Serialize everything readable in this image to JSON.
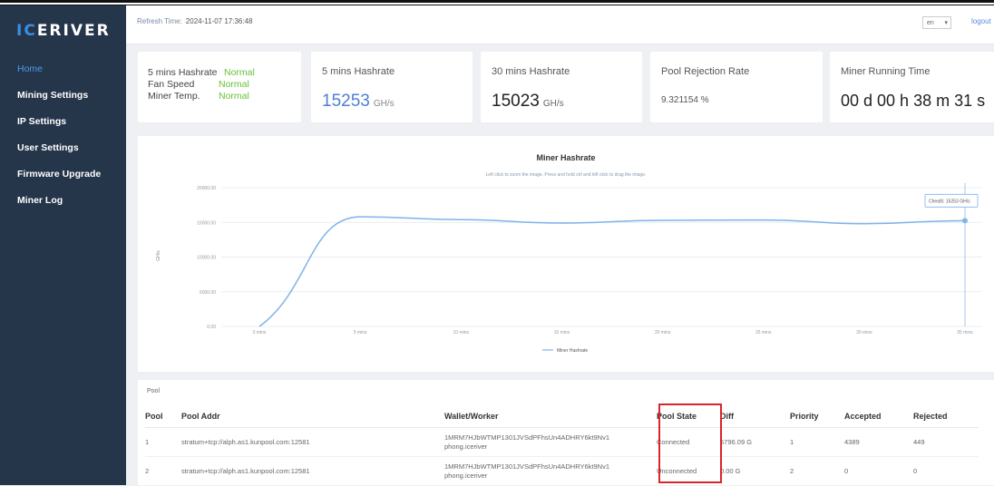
{
  "app": {
    "logo_prefix": "IC",
    "logo_suffix": "ERIVER"
  },
  "sidebar": {
    "items": [
      {
        "label": "Home"
      },
      {
        "label": "Mining Settings"
      },
      {
        "label": "IP Settings"
      },
      {
        "label": "User Settings"
      },
      {
        "label": "Firmware Upgrade"
      },
      {
        "label": "Miner Log"
      }
    ]
  },
  "topbar": {
    "refresh_label": "Refresh Time:",
    "refresh_value": "2024-11-07 17:36:48",
    "language": "en",
    "logout": "logout"
  },
  "status_card": {
    "rows": [
      {
        "label": "5 mins Hashrate",
        "status": "Normal"
      },
      {
        "label": "Fan Speed",
        "status": "Normal"
      },
      {
        "label": "Miner Temp.",
        "status": "Normal"
      }
    ]
  },
  "cards": {
    "hash5": {
      "title": "5 mins Hashrate",
      "value": "15253",
      "unit": "GH/s"
    },
    "hash30": {
      "title": "30 mins Hashrate",
      "value": "15023",
      "unit": "GH/s"
    },
    "rejection": {
      "title": "Pool Rejection Rate",
      "value": "9.321154 %"
    },
    "runtime": {
      "title": "Miner Running Time",
      "value": "00 d 00 h 38 m 31 s"
    }
  },
  "chart": {
    "title": "Miner Hashrate",
    "subtitle": "Left click to zoom the image. Press and hold ctrl and left click to drag the image.",
    "y_axis_label": "GH/s",
    "legend": "Miner Hashrate",
    "tooltip": "Cheat5: 15253 GH/s",
    "accent": "#7fb3ea"
  },
  "chart_data": {
    "type": "line",
    "title": "Miner Hashrate",
    "ylabel": "GH/s",
    "x": [
      "0 mins",
      "5 mins",
      "10 mins",
      "15 mins",
      "20 mins",
      "25 mins",
      "30 mins",
      "35 mins"
    ],
    "series": [
      {
        "name": "Miner Hashrate",
        "values": [
          0,
          15800,
          15400,
          14900,
          15300,
          15350,
          14800,
          15253
        ]
      }
    ],
    "y_ticks": [
      "20000.00",
      "15000.00",
      "10000.00",
      "5000.00",
      "0.00"
    ],
    "ylim": [
      0,
      20000
    ],
    "grid": true,
    "legend_position": "bottom"
  },
  "pools": {
    "caption": "Pool",
    "headers": {
      "pool": "Pool",
      "addr": "Pool Addr",
      "wallet": "Wallet/Worker",
      "state": "Pool State",
      "diff": "Diff",
      "priority": "Priority",
      "accepted": "Accepted",
      "rejected": "Rejected"
    },
    "rows": [
      {
        "pool": "1",
        "addr": "stratum+tcp://alph.as1.kunpool.com:12581",
        "wallet": "1MRM7HJbWTMP1301JVSdPFhsUn4ADHRY6kt9Nv1 phong.iceriver",
        "state": "Connected",
        "diff": "5796.09 G",
        "priority": "1",
        "accepted": "4389",
        "rejected": "449"
      },
      {
        "pool": "2",
        "addr": "stratum+tcp://alph.as1.kunpool.com:12581",
        "wallet": "1MRM7HJbWTMP1301JVSdPFhsUn4ADHRY6kt9Nv1 phong.iceriver",
        "state": "Unconnected",
        "diff": "0.00 G",
        "priority": "2",
        "accepted": "0",
        "rejected": "0"
      }
    ]
  }
}
